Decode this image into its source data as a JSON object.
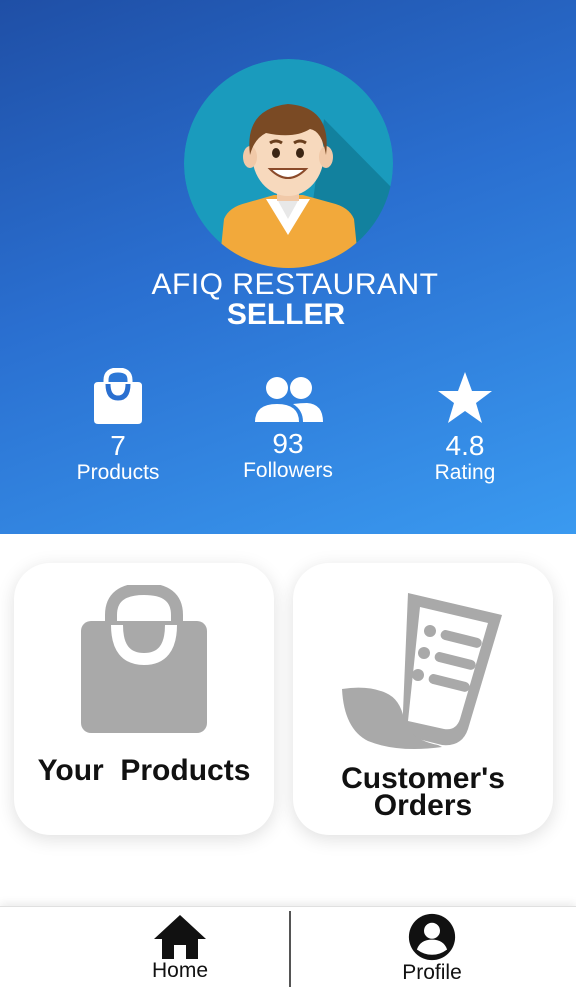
{
  "profile": {
    "shop_name": "AFIQ RESTAURANT",
    "role": "SELLER",
    "avatar_icon": "seller-avatar-icon"
  },
  "stats": {
    "products": {
      "value": "7",
      "label": "Products",
      "icon": "shopping-bag-icon"
    },
    "followers": {
      "value": "93",
      "label": "Followers",
      "icon": "people-icon"
    },
    "rating": {
      "value": "4.8",
      "label": "Rating",
      "icon": "star-icon"
    }
  },
  "cards": {
    "your_products": {
      "label": "Your  Products",
      "icon": "shopping-bag-icon"
    },
    "customer_orders": {
      "label_line1": "Customer's",
      "label_line2": "Orders",
      "icon": "receipt-icon"
    }
  },
  "bottom_nav": {
    "home": {
      "label": "Home",
      "icon": "home-icon"
    },
    "profile": {
      "label": "Profile",
      "icon": "account-circle-icon"
    }
  },
  "colors": {
    "header_gradient_start": "#1f4fa6",
    "header_gradient_end": "#3a9af0",
    "card_icon_gray": "#a9a9a9",
    "avatar_bg": "#1a9bbd"
  }
}
